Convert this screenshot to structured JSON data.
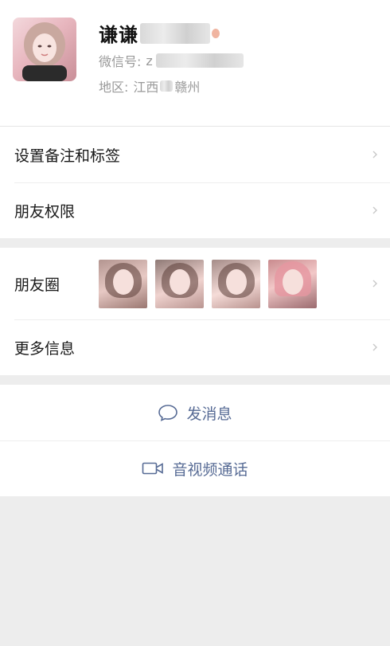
{
  "profile": {
    "name": "谦谦",
    "wechat_id_label": "微信号:",
    "wechat_id_prefix": "z",
    "region_label": "地区:",
    "region_province": "江西",
    "region_city": "赣州"
  },
  "menu": {
    "remark_label": "设置备注和标签",
    "permission_label": "朋友权限",
    "moments_label": "朋友圈",
    "more_info_label": "更多信息"
  },
  "actions": {
    "message_label": "发消息",
    "call_label": "音视频通话"
  },
  "colors": {
    "link": "#576b95",
    "background": "#ededed",
    "panel": "#ffffff"
  }
}
